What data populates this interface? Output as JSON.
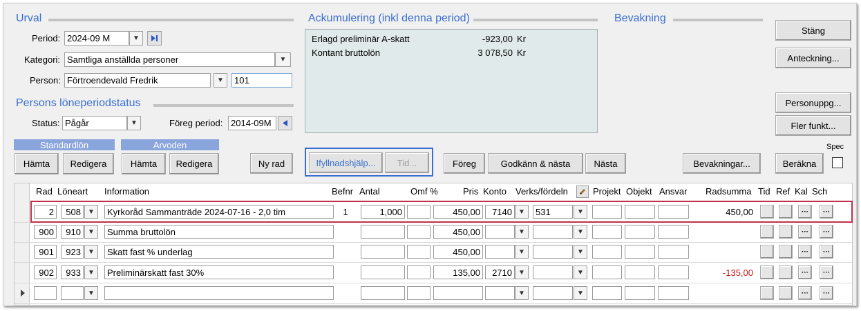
{
  "sections": {
    "urval": "Urval",
    "accum": "Ackumulering (inkl denna period)",
    "bevakning": "Bevakning",
    "status_title": "Persons löneperiodstatus"
  },
  "urval": {
    "period_label": "Period:",
    "period_value": "2024-09 M",
    "kategori_label": "Kategori:",
    "kategori_value": "Samtliga anställda personer",
    "person_label": "Person:",
    "person_value": "Förtroendevald Fredrik",
    "person_id": "101"
  },
  "status": {
    "status_label": "Status:",
    "status_value": "Pågår",
    "foreg_label": "Föreg period:",
    "foreg_value": "2014-09M"
  },
  "accum": {
    "rows": [
      {
        "label": "Erlagd preliminär A-skatt",
        "value": "-923,00",
        "unit": "Kr"
      },
      {
        "label": "Kontant bruttolön",
        "value": "3 078,50",
        "unit": "Kr"
      }
    ]
  },
  "right_buttons": {
    "stang": "Stäng",
    "anteckning": "Anteckning...",
    "personuppg": "Personuppg...",
    "fler": "Fler funkt...",
    "bevakningar": "Bevakningar...",
    "berakna": "Beräkna",
    "spec_label": "Spec"
  },
  "groups": {
    "standardlon": "Standardlön",
    "arvoden": "Arvoden",
    "hamta": "Hämta",
    "redigera": "Redigera"
  },
  "actions": {
    "nyrad": "Ny rad",
    "ifyll": "Ifyllnadshjälp...",
    "tid": "Tid...",
    "foreg": "Föreg",
    "godkann": "Godkänn & nästa",
    "nasta": "Nästa"
  },
  "grid": {
    "headers": {
      "rad": "Rad",
      "loneart": "Löneart",
      "information": "Information",
      "befnr": "Befnr",
      "antal": "Antal",
      "omf": "Omf %",
      "pris": "Pris",
      "konto": "Konto",
      "verks": "Verks/fördeln",
      "projekt": "Projekt",
      "objekt": "Objekt",
      "ansvar": "Ansvar",
      "radsumma": "Radsumma",
      "tid": "Tid",
      "ref": "Ref",
      "kal": "Kal",
      "sch": "Sch"
    },
    "rows": [
      {
        "rad": "2",
        "loneart": "508",
        "info": "Kyrkoråd Sammanträde 2024-07-16 - 2,0 tim",
        "befnr": "1",
        "antal": "1,000",
        "omf": "",
        "pris": "450,00",
        "konto": "7140",
        "verks": "531",
        "radsumma": "450,00",
        "neg": false
      },
      {
        "rad": "900",
        "loneart": "910",
        "info": "Summa bruttolön",
        "befnr": "",
        "antal": "",
        "omf": "",
        "pris": "450,00",
        "konto": "",
        "verks": "",
        "radsumma": "",
        "neg": false
      },
      {
        "rad": "901",
        "loneart": "923",
        "info": "Skatt fast % underlag",
        "befnr": "",
        "antal": "",
        "omf": "",
        "pris": "450,00",
        "konto": "",
        "verks": "",
        "radsumma": "",
        "neg": false
      },
      {
        "rad": "902",
        "loneart": "933",
        "info": "Preliminärskatt fast 30%",
        "befnr": "",
        "antal": "",
        "omf": "",
        "pris": "135,00",
        "konto": "2710",
        "verks": "",
        "radsumma": "-135,00",
        "neg": true
      },
      {
        "rad": "",
        "loneart": "",
        "info": "",
        "befnr": "",
        "antal": "",
        "omf": "",
        "pris": "",
        "konto": "",
        "verks": "",
        "radsumma": "",
        "neg": false
      }
    ],
    "highlight_color": "#c0304a",
    "negative_color": "#c01818"
  },
  "icons": {
    "dropdown": "chevron-down-icon",
    "next": "skip-forward-icon",
    "back": "triangle-left-icon",
    "pencil": "pencil-icon",
    "ellipsis": "ellipsis-icon",
    "row_indicator": "row-pointer-icon"
  },
  "colors": {
    "section_title": "#3a6fd0",
    "group_header": "#8aa4dc",
    "accum_bg": "#e1eaea",
    "focus_box": "#3a6fd0"
  }
}
